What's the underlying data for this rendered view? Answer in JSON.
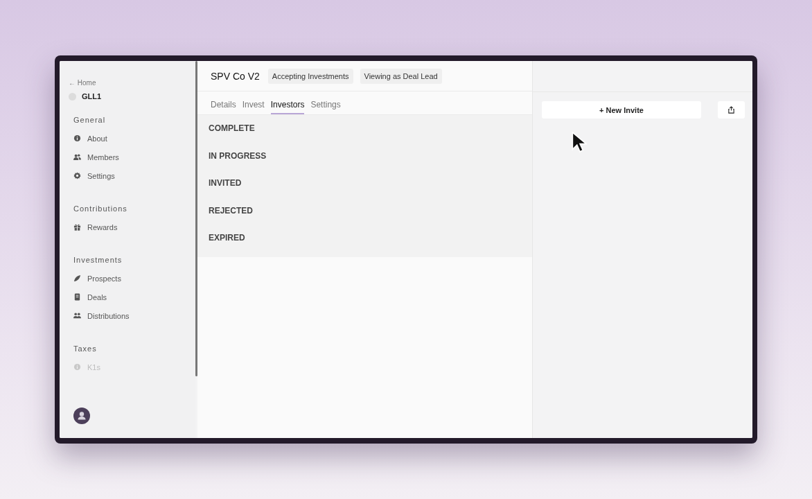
{
  "sidebar": {
    "back_link": "← Home",
    "org": "GLL1",
    "sections": [
      {
        "title": "General",
        "items": [
          {
            "kind": "info",
            "label": "About",
            "disabled": false
          },
          {
            "kind": "people",
            "label": "Members",
            "disabled": false
          },
          {
            "kind": "gear",
            "label": "Settings",
            "disabled": false
          }
        ]
      },
      {
        "title": "Contributions",
        "items": [
          {
            "kind": "gift",
            "label": "Rewards",
            "disabled": false
          }
        ]
      },
      {
        "title": "Investments",
        "items": [
          {
            "kind": "leaf",
            "label": "Prospects",
            "disabled": false
          },
          {
            "kind": "doc",
            "label": "Deals",
            "disabled": false
          },
          {
            "kind": "group",
            "label": "Distributions",
            "disabled": false
          }
        ]
      },
      {
        "title": "Taxes",
        "items": [
          {
            "kind": "info",
            "label": "K1s",
            "disabled": true
          }
        ]
      }
    ]
  },
  "header": {
    "title": "SPV Co V2",
    "badges": [
      "Accepting Investments",
      "Viewing as Deal Lead"
    ]
  },
  "tabs": [
    {
      "label": "Details",
      "selected": false
    },
    {
      "label": "Invest",
      "selected": false
    },
    {
      "label": "Investors",
      "selected": true
    },
    {
      "label": "Settings",
      "selected": false
    }
  ],
  "groups": [
    "COMPLETE",
    "IN PROGRESS",
    "INVITED",
    "REJECTED",
    "EXPIRED"
  ],
  "side_panel": {
    "new_invite_button": "+ New Invite"
  }
}
